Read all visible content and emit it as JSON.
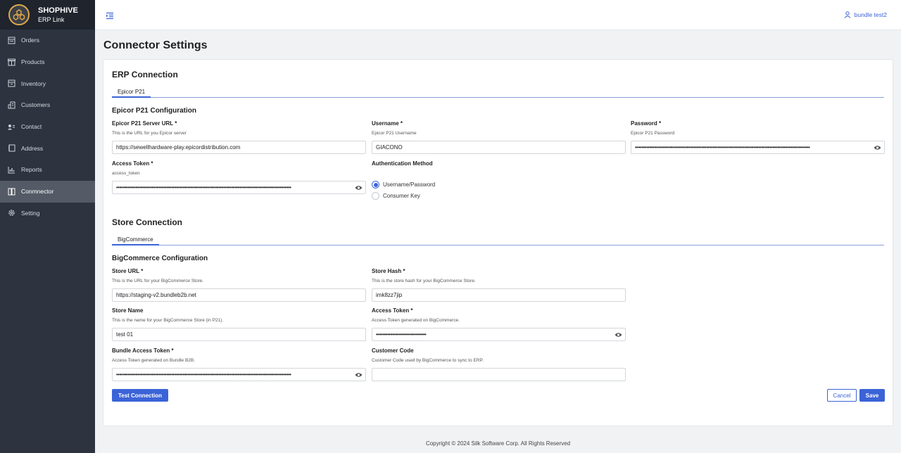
{
  "brand": {
    "title": "SHOPHIVE",
    "subtitle": "ERP Link"
  },
  "sidebar": {
    "items": [
      {
        "label": "Orders",
        "icon": "orders-icon"
      },
      {
        "label": "Products",
        "icon": "box-icon"
      },
      {
        "label": "Inventory",
        "icon": "archive-icon"
      },
      {
        "label": "Customers",
        "icon": "building-icon"
      },
      {
        "label": "Contact",
        "icon": "contact-card-icon"
      },
      {
        "label": "Address",
        "icon": "address-book-icon"
      },
      {
        "label": "Reports",
        "icon": "bar-chart-icon"
      },
      {
        "label": "Conmnector",
        "icon": "connector-icon",
        "active": true
      },
      {
        "label": "Setting",
        "icon": "gear-icon"
      }
    ]
  },
  "header": {
    "user_name": "bundle test2"
  },
  "page": {
    "title": "Connector Settings"
  },
  "erp": {
    "section_title": "ERP Connection",
    "tab": "Epicor P21",
    "config_title": "Epicor P21 Configuration",
    "server_url": {
      "label": "Epicor P21 Server URL *",
      "help": "This is the URL for you Epicor server",
      "value": "https://sewellhardware-play.epicordistribution.com"
    },
    "username": {
      "label": "Username *",
      "help": "Epicor P21 Username",
      "value": "GIACONO"
    },
    "password": {
      "label": "Password *",
      "help": "Epicor P21 Password",
      "value": "••••••••••••••••••••••••••••••••••••••••••••••••••••••••••••••••••••••••••••••••••••••••••••••••••••••••••••"
    },
    "access_token": {
      "label": "Access Token *",
      "help": "access_token",
      "value": "••••••••••••••••••••••••••••••••••••••••••••••••••••••••••••••••••••••••••••••••••••••••••••••••••••••••••••"
    },
    "auth_method": {
      "label": "Authentication Method",
      "options": [
        "Username/Password",
        "Consumer Key"
      ],
      "selected": "Username/Password"
    }
  },
  "store": {
    "section_title": "Store Connection",
    "tab": "BigCommerce",
    "config_title": "BigCommerce Configuration",
    "store_url": {
      "label": "Store URL *",
      "help": "This is the URL for your BigCommerce Store.",
      "value": "https://staging-v2.bundleb2b.net"
    },
    "store_hash": {
      "label": "Store Hash *",
      "help": "This is the store hash for your BigCommerce Store.",
      "value": "imk8zz7jip"
    },
    "store_name": {
      "label": "Store Name",
      "help": "This is the name for your BigCommerce Store (in P21).",
      "value": "test 01"
    },
    "access_token": {
      "label": "Access Token *",
      "help": "Access Token generated on BigCommerce.",
      "value": "•••••••••••••••••••••••••••••••"
    },
    "bundle_token": {
      "label": "Bundle Access Token *",
      "help": "Access Token generated on Bundle B2B.",
      "value": "••••••••••••••••••••••••••••••••••••••••••••••••••••••••••••••••••••••••••••••••••••••••••••••••••••••••••••"
    },
    "customer_code": {
      "label": "Customer Code",
      "help": "Customer Code used by BigCommerce to sync to ERP.",
      "value": ""
    }
  },
  "actions": {
    "test": "Test Connection",
    "cancel": "Cancel",
    "save": "Save"
  },
  "footer": {
    "copyright": "Copyright © 2024 Silk Software Corp. All Rights Reserved"
  },
  "colors": {
    "accent": "#3b63d8",
    "sidebar_bg": "#2d3440",
    "sidebar_active": "#545b66"
  }
}
